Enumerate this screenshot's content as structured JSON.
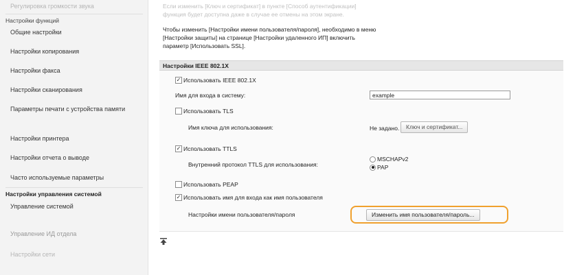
{
  "sidebar": {
    "top_item": "Регулировка громкости звука",
    "section_functions": "Настройки функций",
    "function_items": [
      "Общие настройки",
      "Настройки копирования",
      "Настройки факса",
      "Настройки сканирования",
      "Параметры печати с устройства памяти",
      "Настройки принтера",
      "Настройки отчета о выводе",
      "Часто используемые параметры"
    ],
    "section_management": "Настройки управления системой",
    "management_items": [
      "Управление системой",
      "Управление ИД отдела",
      "Настройки сети"
    ]
  },
  "notes": {
    "line0": "Если изменить [Ключ и сертификат] в пункте [Способ аутентификации]",
    "line1": "функция будет доступна даже в случае ее отмены на этом экране.",
    "line2": "Чтобы изменить [Настройки имени пользователя/пароля], необходимо в меню",
    "line3": "[Настройки защиты] на странице [Настройки удаленного ИП] включить",
    "line4": "параметр [Использовать SSL]."
  },
  "ieee": {
    "section_title": "Настройки IEEE 802.1X",
    "use_ieee_label": "Использовать IEEE 802.1X",
    "use_ieee_checked": true,
    "login_label": "Имя для входа в систему:",
    "login_value": "example",
    "use_tls_label": "Использовать TLS",
    "use_tls_checked": false,
    "key_name_label": "Имя ключа для использования:",
    "key_status": "Не задано.",
    "key_button": "Ключ и сертификат...",
    "use_ttls_label": "Использовать TTLS",
    "use_ttls_checked": true,
    "inner_protocol_label": "Внутренний протокол TTLS для использования:",
    "inner_options": [
      "MSCHAPv2",
      "PAP"
    ],
    "inner_selected": "PAP",
    "use_peap_label": "Использовать PEAP",
    "use_peap_checked": false,
    "use_login_as_user_label": "Использовать имя для входа как имя пользователя",
    "use_login_as_user_checked": true,
    "user_settings_label": "Настройки имени пользователя/пароля",
    "change_button": "Изменить имя пользователя/пароль..."
  },
  "colors": {
    "highlight": "#f0a02c",
    "section_header_bg": "#e6e6e6",
    "sidebar_bg": "#f3f3f3"
  },
  "icons": {
    "back_to_top": "back-to-top-icon"
  }
}
